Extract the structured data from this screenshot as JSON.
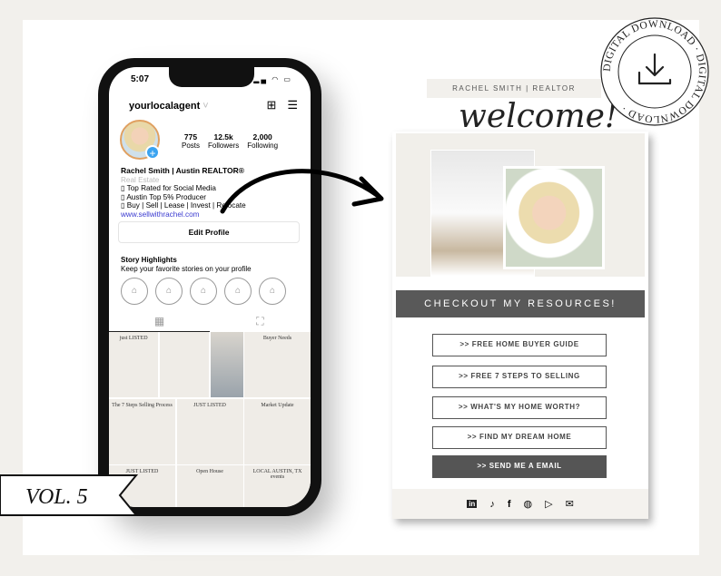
{
  "phone": {
    "time": "5:07",
    "username": "yourlocalagent",
    "stats": [
      {
        "value": "775",
        "label": "Posts"
      },
      {
        "value": "12.5k",
        "label": "Followers"
      },
      {
        "value": "2,000",
        "label": "Following"
      }
    ],
    "bio": {
      "name": "Rachel Smith | Austin REALTOR®",
      "category": "Real Estate",
      "lines": [
        "▯ Top Rated for Social Media",
        "▯ Austin Top 5% Producer",
        "▯ Buy | Sell | Lease | Invest | Relocate"
      ],
      "link": "www.sellwithrachel.com"
    },
    "edit_profile": "Edit Profile",
    "story_title": "Story Highlights",
    "story_sub": "Keep your favorite stories on your profile",
    "grid": [
      "just LISTED",
      "",
      "",
      "Buyer Needs",
      "The 7 Steps Selling Process",
      "JUST LISTED",
      "Market Update",
      "JUST LISTED",
      "Open House",
      "LOCAL AUSTIN, TX events"
    ]
  },
  "page": {
    "header": "RACHEL SMITH | REALTOR",
    "welcome": "welcome!",
    "banner": "CHECKOUT MY RESOURCES!",
    "buttons": [
      ">> FREE HOME BUYER GUIDE",
      ">> FREE 7 STEPS TO SELLING",
      ">> WHAT'S MY HOME WORTH?",
      ">> FIND MY DREAM HOME",
      ">> SEND ME A EMAIL"
    ],
    "social_icons": [
      "linkedin-icon",
      "tiktok-icon",
      "facebook-icon",
      "globe-icon",
      "youtube-icon",
      "mail-icon"
    ]
  },
  "badge": {
    "text": "DIGITAL DOWNLOAD · DIGITAL DOWNLOAD ·"
  },
  "volume": "VOL. 5",
  "colors": {
    "dark": "#595959",
    "beige": "#f1efea",
    "link": "#3b3bd0",
    "accent": "#3aa3f0"
  }
}
